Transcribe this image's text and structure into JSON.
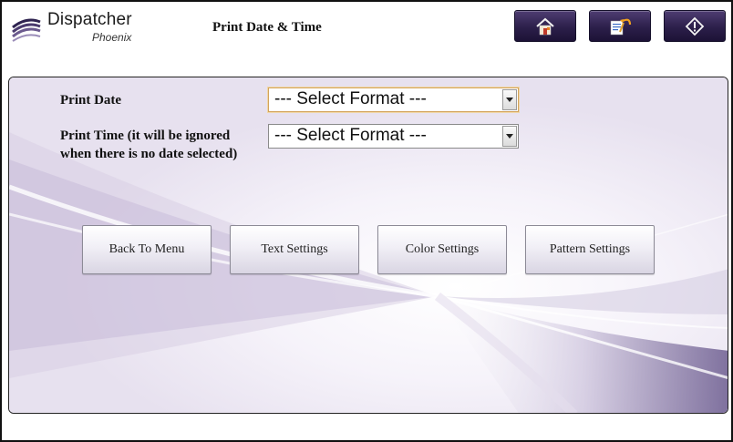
{
  "app": {
    "name": "Dispatcher",
    "subtitle": "Phoenix",
    "page_title": "Print Date & Time"
  },
  "header": {
    "home_icon": "home-icon",
    "edit_icon": "edit-undo-icon",
    "info_icon": "info-icon"
  },
  "form": {
    "print_date_label": "Print Date",
    "print_date_value": "--- Select Format ---",
    "print_time_label": "Print Time (it will be ignored when there is no date selected)",
    "print_time_value": "--- Select Format ---"
  },
  "buttons": {
    "back": "Back To Menu",
    "text": "Text Settings",
    "color": "Color Settings",
    "pattern": "Pattern Settings"
  },
  "colors": {
    "header_button": "#2c1f4a",
    "accent_purple": "#6b5a8e",
    "focus_border": "#d3a35a"
  }
}
